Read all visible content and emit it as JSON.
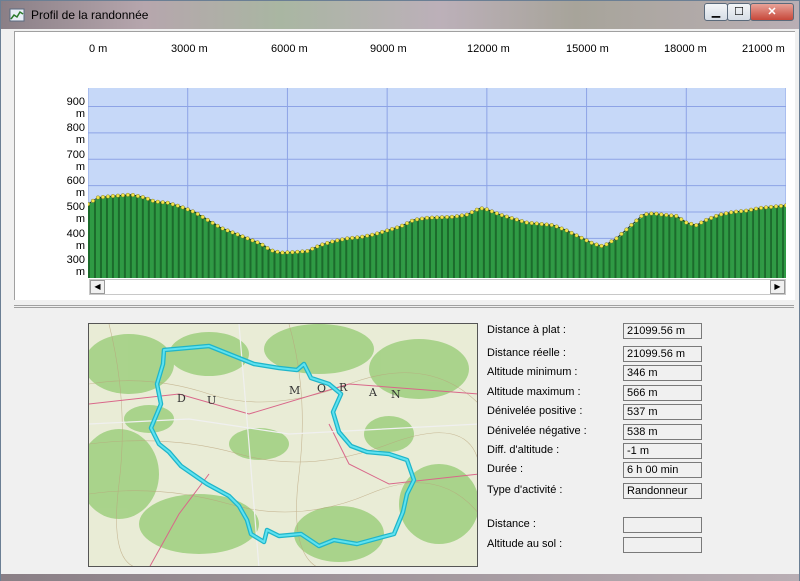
{
  "window": {
    "title": "Profil de la randonnée"
  },
  "controls": {
    "minimize": "▁",
    "maximize": "☐",
    "close": "✕"
  },
  "chart_data": {
    "type": "area",
    "x_ticks": [
      "0 m",
      "3000 m",
      "6000 m",
      "9000 m",
      "12000 m",
      "15000 m",
      "18000 m",
      "21000 m"
    ],
    "y_ticks": [
      "900 m",
      "800 m",
      "700 m",
      "600 m",
      "500 m",
      "400 m",
      "300 m"
    ],
    "xlim": [
      0,
      21000
    ],
    "ylim": [
      250,
      970
    ],
    "x": [
      0,
      300,
      700,
      1000,
      1300,
      1700,
      2000,
      2400,
      2800,
      3200,
      3600,
      4000,
      4400,
      4800,
      5200,
      5500,
      5800,
      6200,
      6600,
      7000,
      7400,
      7800,
      8200,
      8600,
      9000,
      9400,
      9800,
      10200,
      10600,
      11000,
      11400,
      11800,
      12000,
      12400,
      12800,
      13200,
      13600,
      14000,
      14400,
      14800,
      15200,
      15500,
      15900,
      16300,
      16700,
      17000,
      17300,
      17700,
      18000,
      18300,
      18600,
      19000,
      19400,
      19800,
      20200,
      20600,
      21000
    ],
    "y": [
      530,
      555,
      560,
      563,
      566,
      555,
      540,
      535,
      520,
      500,
      470,
      440,
      420,
      400,
      380,
      355,
      346,
      348,
      352,
      375,
      390,
      400,
      405,
      415,
      430,
      445,
      470,
      478,
      480,
      482,
      490,
      515,
      510,
      490,
      475,
      460,
      455,
      450,
      430,
      405,
      380,
      370,
      400,
      445,
      490,
      495,
      490,
      485,
      460,
      450,
      470,
      490,
      500,
      505,
      515,
      520,
      525
    ],
    "colors": {
      "sky": "#c6d8f8",
      "ground": "#2f9a44",
      "dots": "#f2e64a",
      "grid": "#8da3e6"
    }
  },
  "stats": {
    "rows": [
      {
        "label": "Distance à plat :",
        "value": "21099.56 m"
      },
      {
        "label": "Distance réelle :",
        "value": "21099.56 m"
      },
      {
        "label": "Altitude minimum :",
        "value": "346 m"
      },
      {
        "label": "Altitude maximum :",
        "value": "566 m"
      },
      {
        "label": "Dénivelée positive :",
        "value": "537 m"
      },
      {
        "label": "Dénivelée négative :",
        "value": "538 m"
      },
      {
        "label": "Diff. d'altitude :",
        "value": "-1 m"
      },
      {
        "label": "Durée :",
        "value": "6 h 00 min"
      },
      {
        "label": "Type d'activité :",
        "value": "Randonneur"
      }
    ],
    "cursor": [
      {
        "label": "Distance :",
        "value": ""
      },
      {
        "label": "Altitude au sol :",
        "value": ""
      }
    ]
  },
  "map": {
    "labels": [
      "D",
      "U",
      "M",
      "O",
      "R",
      "A",
      "N"
    ]
  }
}
